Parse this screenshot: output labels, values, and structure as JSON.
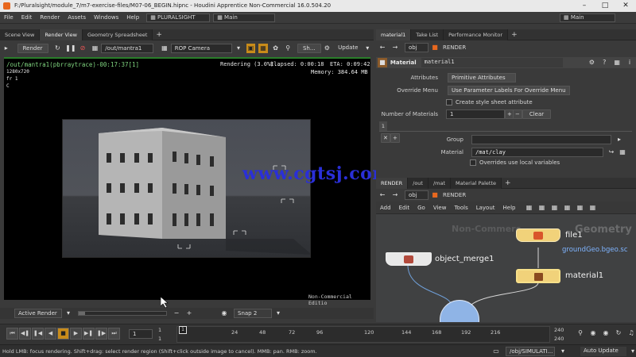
{
  "window": {
    "title": "F:/Pluralsight/module_7/m7-exercise-files/M07-06_BEGIN.hipnc - Houdini Apprentice Non-Commercial 16.0.504.20"
  },
  "menubar": {
    "items": [
      "File",
      "Edit",
      "Render",
      "Assets",
      "Windows",
      "Help"
    ],
    "shelf_set": "PLURALSIGHT",
    "desktop": "Main",
    "desktop_right": "Main"
  },
  "left_tabs": [
    "Scene View",
    "Render View",
    "Geometry Spreadsheet"
  ],
  "render_toolbar": {
    "render_label": "Render",
    "driver_path": "/out/mantra1",
    "camera": "ROP Camera",
    "sh_label": "Sh...",
    "update_label": "Update"
  },
  "render_view": {
    "info_path": "/out/mantra1(pbrraytrace)-00:17:37[1]",
    "resolution": "1280x720",
    "frame": "fr 1",
    "channel": "C",
    "status": "Rendering (3.0%)..",
    "elapsed": "Elapsed: 0:00:18",
    "eta": "ETA: 0:09:42",
    "memory": "Memory:  384.64 MB",
    "watermark": "www.cgtsj.com",
    "noncommercial": "Non-Commercial Editio"
  },
  "render_bottom": {
    "active_render": "Active Render",
    "snap": "Snap 2"
  },
  "param_tabs": [
    "material1",
    "Take List",
    "Performance Monitor"
  ],
  "param_path": {
    "obj": "obj",
    "node": "RENDER"
  },
  "material_panel": {
    "type_label": "Material",
    "node_name": "material1",
    "attributes_label": "Attributes",
    "attributes_value": "Primitive Attributes",
    "override_label": "Override Menu",
    "override_value": "Use Parameter Labels For Override Menu",
    "style_sheet": "Create style sheet attribute",
    "num_mat_label": "Number of Materials",
    "num_mat_value": "1",
    "clear_label": "Clear",
    "index_label": "1",
    "group_label": "Group",
    "group_value": "",
    "material_label": "Material",
    "material_value": "/mat/clay",
    "overrides_local": "Overrides use local variables"
  },
  "net_tabs": [
    "RENDER",
    "/out",
    "/mat",
    "Material Palette"
  ],
  "net_path": {
    "obj": "obj",
    "node": "RENDER"
  },
  "net_menu": [
    "Add",
    "Edit",
    "Go",
    "View",
    "Tools",
    "Layout",
    "Help"
  ],
  "network": {
    "watermark_left": "Non-Commerc",
    "context_label": "Geometry",
    "nodes": [
      {
        "name": "file1",
        "sublabel": "groundGeo.bgeo.sc"
      },
      {
        "name": "object_merge1"
      },
      {
        "name": "material1"
      }
    ]
  },
  "timeline": {
    "current_frame": "1",
    "start_frame": "1",
    "start_frame2": "1",
    "marker": "1",
    "ticks": [
      "24",
      "48",
      "72",
      "96",
      "120",
      "144",
      "168",
      "192",
      "216"
    ],
    "end_frame": "240",
    "end_frame2": "240"
  },
  "status": {
    "hint": "Hold LMB: focus rendering. Shift+drag: select render region (Shift+click outside image to cancel). MMB: pan. RMB: zoom.",
    "sim_path": "/obj/SIMULATI...",
    "auto_update": "Auto Update"
  },
  "colors": {
    "accent_orange": "#c88b1a",
    "render_bar_green": "#2b7d2b",
    "material_blue": "#7fb4ff",
    "net_link_blue": "#6f9fd8"
  }
}
